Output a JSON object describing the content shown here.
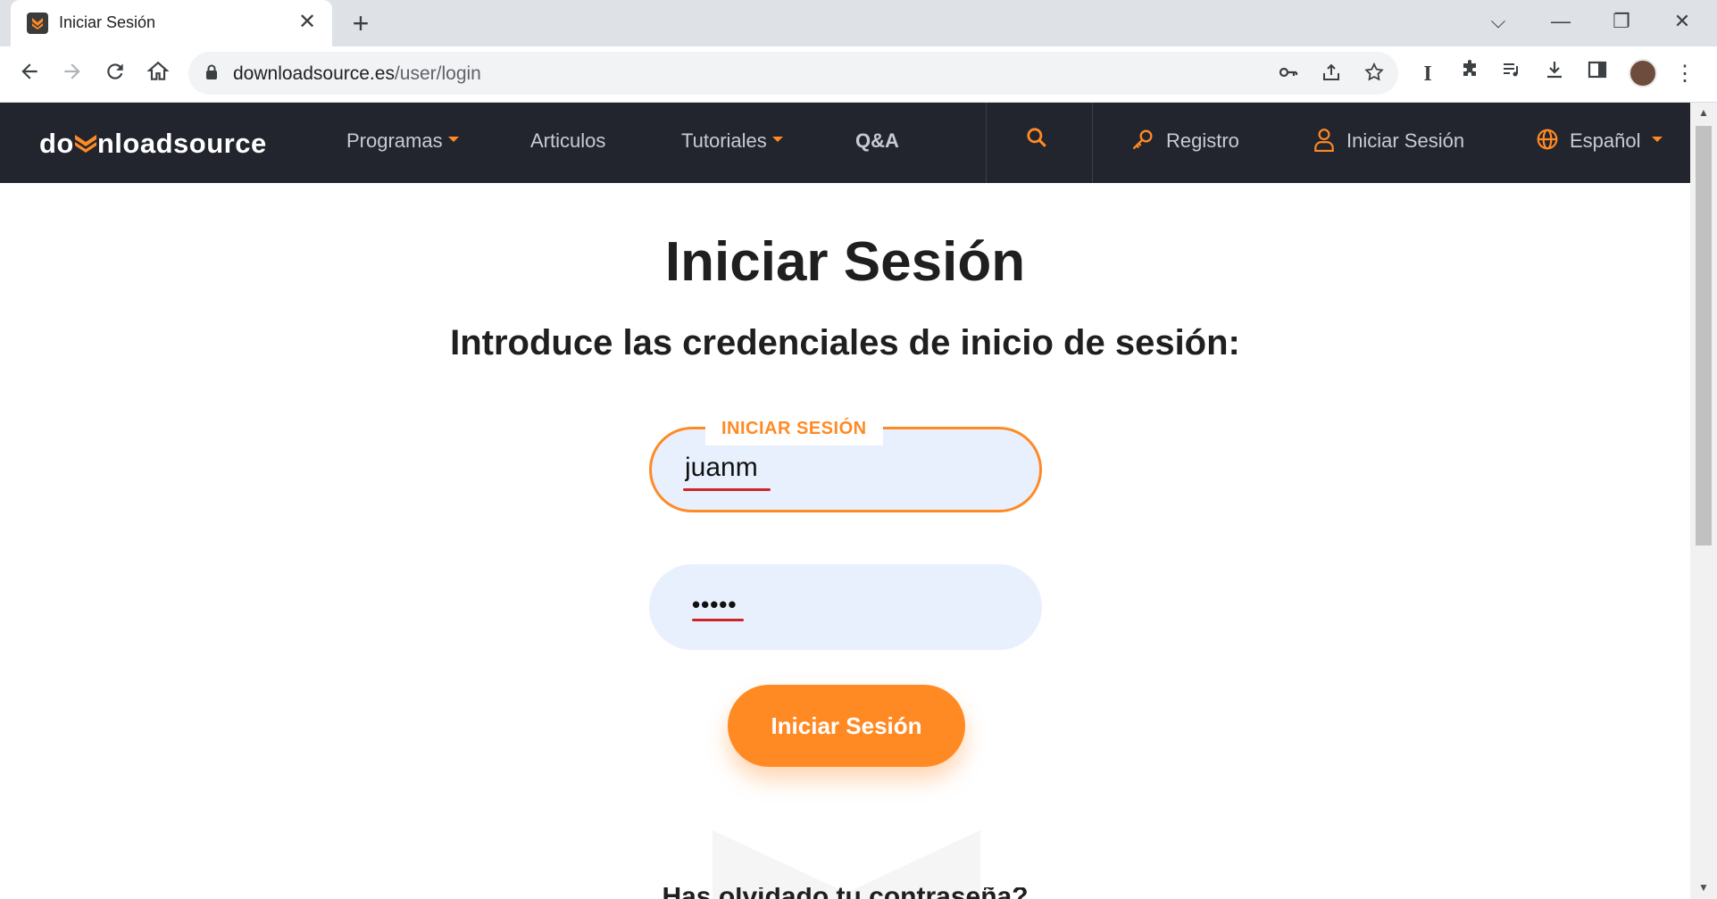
{
  "browser": {
    "tab_title": "Iniciar Sesión",
    "tab_close": "✕",
    "new_tab": "+",
    "url_domain": "downloadsource.es",
    "url_path": "/user/login",
    "window_controls": {
      "dropdown": "⌵",
      "minimize": "—",
      "restore": "❐",
      "close": "✕"
    }
  },
  "site": {
    "logo_prefix": "do",
    "logo_suffix": "nloadsource",
    "nav": {
      "programas": "Programas",
      "articulos": "Articulos",
      "tutoriales": "Tutoriales",
      "qa": "Q&A",
      "registro": "Registro",
      "iniciar_sesion": "Iniciar Sesión",
      "idioma": "Español"
    },
    "accent_color": "#ff8a24",
    "header_bg": "#22252e"
  },
  "login": {
    "title": "Iniciar Sesión",
    "subtitle": "Introduce las credenciales de inicio de sesión:",
    "username_legend": "INICIAR SESIÓN",
    "username_value": "juanm",
    "password_mask": "•••••",
    "submit_label": "Iniciar Sesión",
    "partial_next_line": "Has olvidado tu contraseña?"
  }
}
